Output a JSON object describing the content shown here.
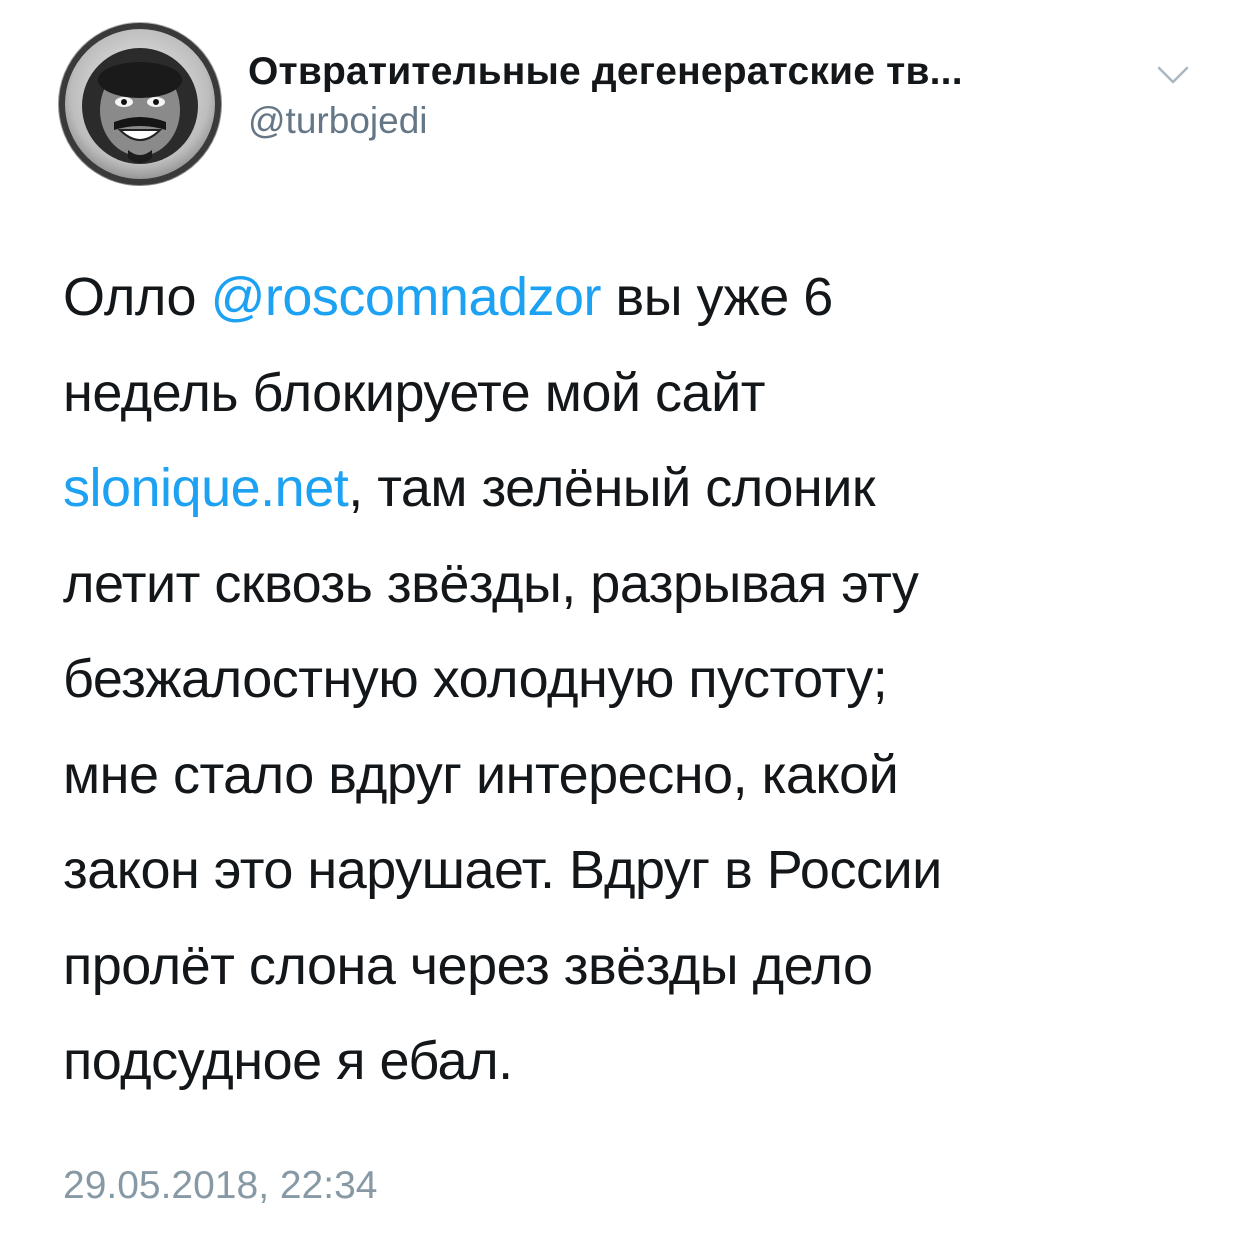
{
  "author": {
    "display_name": "Отвратительные дегенератские тв...",
    "handle": "@turbojedi",
    "avatar_icon": "cosmonaut-avatar",
    "menu_icon": "chevron-down-icon"
  },
  "tweet": {
    "lines": [
      {
        "pre": "Олло ",
        "link": "@roscomnadzor",
        "post": " вы уже 6"
      },
      {
        "pre": "недель блокируете мой сайт",
        "link": "",
        "post": ""
      },
      {
        "pre": "",
        "link": "slonique.net",
        "post": ", там зелёный слоник"
      },
      {
        "pre": "летит сквозь звёзды, разрывая эту",
        "link": "",
        "post": ""
      },
      {
        "pre": "безжалостную холодную пустоту;",
        "link": "",
        "post": ""
      },
      {
        "pre": "мне стало вдруг интересно, какой",
        "link": "",
        "post": ""
      },
      {
        "pre": "закон это нарушает. Вдруг в России",
        "link": "",
        "post": ""
      },
      {
        "pre": "пролёт слона через звёзды дело",
        "link": "",
        "post": ""
      },
      {
        "pre": "подсудное я ебал.",
        "link": "",
        "post": ""
      }
    ],
    "timestamp": "29.05.2018, 22:34"
  },
  "colors": {
    "text": "#14171a",
    "secondary": "#657786",
    "link": "#1da1f2",
    "timestamp": "#8899a6"
  }
}
